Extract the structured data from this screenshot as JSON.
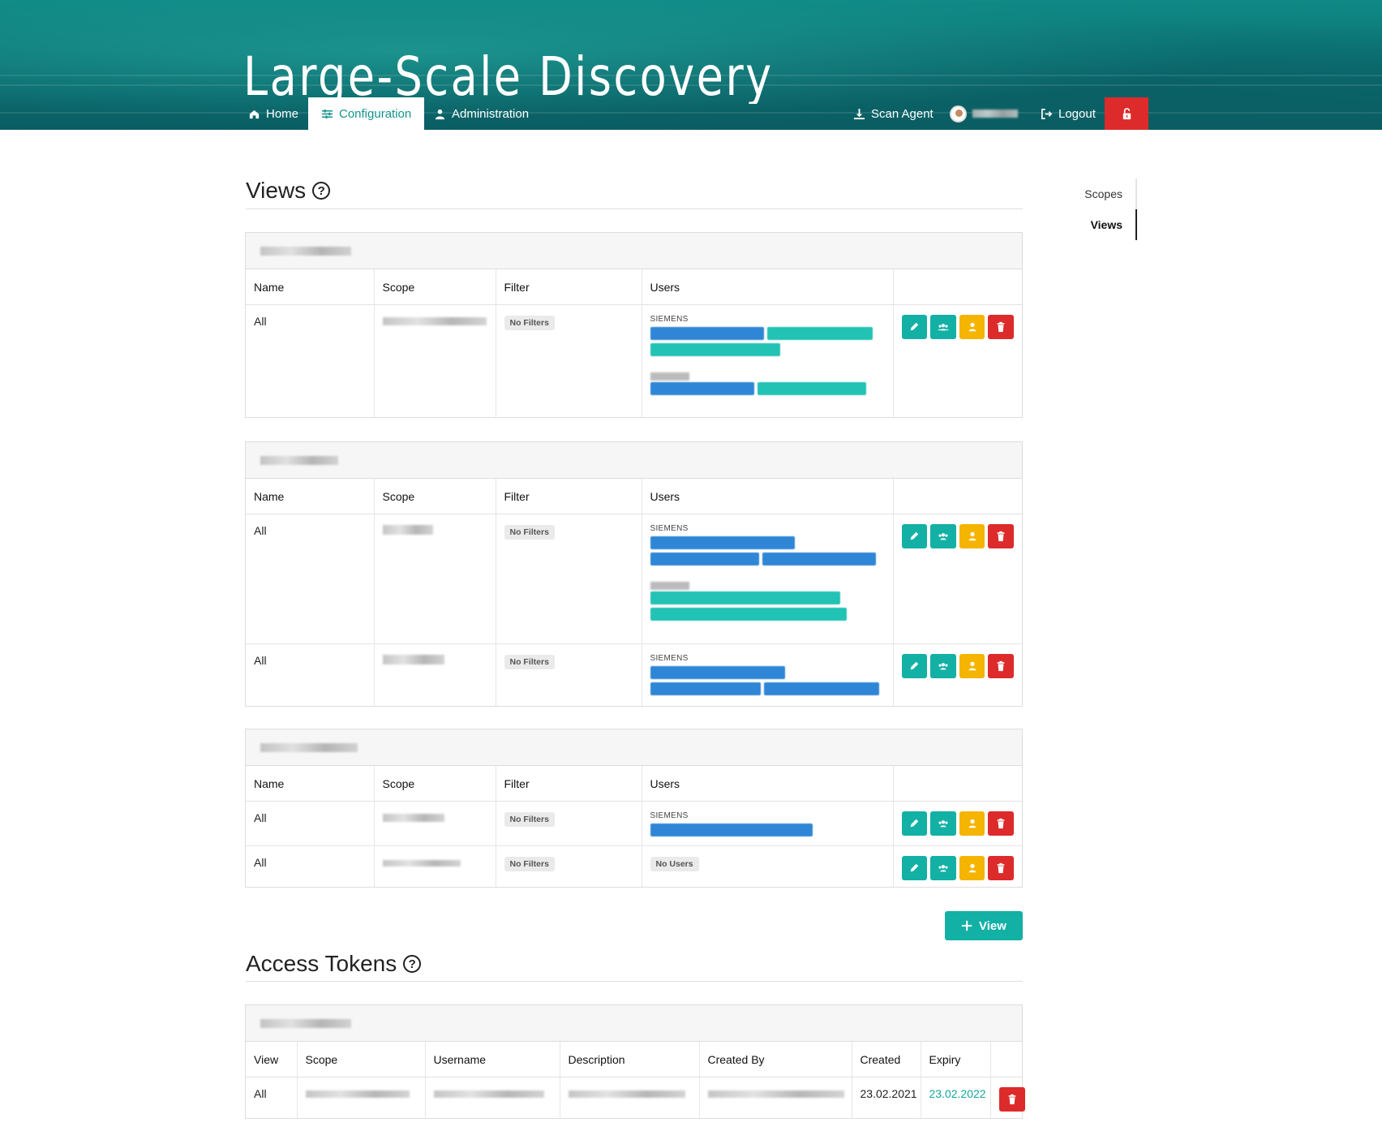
{
  "app": {
    "title": "Large-Scale Discovery"
  },
  "nav": {
    "home": "Home",
    "configuration": "Configuration",
    "administration": "Administration",
    "scan_agent": "Scan Agent",
    "logout": "Logout"
  },
  "side_nav": {
    "items": [
      "Scopes",
      "Views"
    ],
    "active": "Views"
  },
  "views": {
    "title": "Views",
    "columns": [
      "Name",
      "Scope",
      "Filter",
      "Users"
    ],
    "groups": [
      {
        "rows": [
          {
            "name": "All",
            "filter": "No Filters",
            "org": "SIEMENS"
          }
        ]
      },
      {
        "rows": [
          {
            "name": "All",
            "filter": "No Filters",
            "org": "SIEMENS"
          },
          {
            "name": "All",
            "filter": "No Filters",
            "org": "SIEMENS"
          }
        ]
      },
      {
        "rows": [
          {
            "name": "All",
            "filter": "No Filters",
            "org": "SIEMENS"
          },
          {
            "name": "All",
            "filter": "No Filters",
            "users": "No Users"
          }
        ]
      }
    ],
    "add_button": "View"
  },
  "tokens": {
    "title": "Access Tokens",
    "columns": [
      "View",
      "Scope",
      "Username",
      "Description",
      "Created By",
      "Created",
      "Expiry"
    ],
    "rows": [
      {
        "view": "All",
        "created": "23.02.2021",
        "expiry": "23.02.2022"
      }
    ]
  },
  "colors": {
    "teal": "#13b0a5",
    "yellow": "#f5b400",
    "red": "#dd2a2a",
    "chip_blue": "#2f86d6",
    "chip_teal": "#22c2b4"
  },
  "icons": [
    "home-icon",
    "sliders-icon",
    "admin-user-icon",
    "download-icon",
    "avatar",
    "logout-icon",
    "unlock-icon",
    "help-icon",
    "pencil-icon",
    "users-icon",
    "user-icon",
    "trash-icon",
    "plus-icon"
  ]
}
